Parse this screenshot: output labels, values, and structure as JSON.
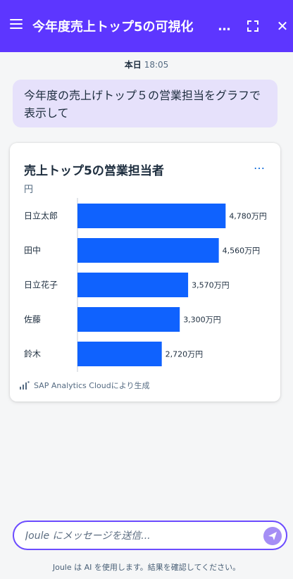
{
  "header": {
    "title": "今年度売上トップ5の可視化",
    "more_icon": "…",
    "close_icon": "✕",
    "color": "#5d36ff"
  },
  "timestamp": {
    "day": "本日",
    "time": "18:05"
  },
  "message": {
    "text": "今年度の売上げトップ５の営業担当をグラフで表示して"
  },
  "card": {
    "more_icon": "…",
    "footer": "SAP Analytics Cloudにより生成"
  },
  "chart_data": {
    "type": "bar",
    "orientation": "horizontal",
    "title": "売上トップ5の営業担当者",
    "unit": "円",
    "categories": [
      "日立太郎",
      "田中",
      "日立花子",
      "佐藤",
      "鈴木"
    ],
    "values": [
      4780,
      4560,
      3570,
      3300,
      2720
    ],
    "labels": [
      "4,780万円",
      "4,560万円",
      "3,570万円",
      "3,300万円",
      "2,720万円"
    ],
    "value_unit": "万円",
    "bar_color": "#0f62fe",
    "xlim": [
      0,
      5000
    ],
    "grid": false,
    "legend": "none"
  },
  "input": {
    "placeholder": "Joule にメッセージを送信..."
  },
  "disclaimer": "Joule は AI を使用します。結果を確認してください。"
}
